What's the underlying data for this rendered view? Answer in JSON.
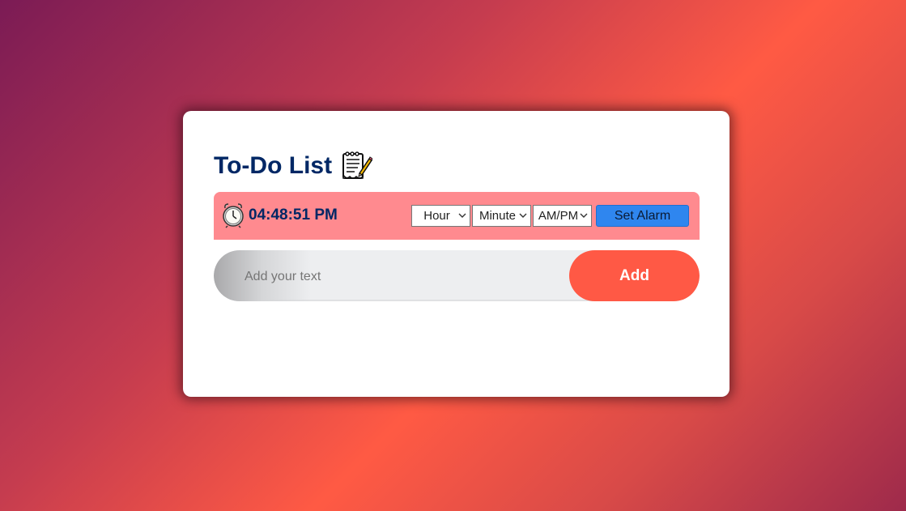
{
  "app": {
    "title": "To-Do List"
  },
  "alarm": {
    "current_time": "04:48:51 PM",
    "hour_select": {
      "selected": "Hour"
    },
    "minute_select": {
      "selected": "Minute"
    },
    "ampm_select": {
      "selected": "AM/PM"
    },
    "set_alarm_label": "Set Alarm"
  },
  "input": {
    "placeholder": "Add your text",
    "value": ""
  },
  "add_button_label": "Add",
  "icons": {
    "title_icon": "notepad-pencil-icon",
    "clock_icon": "alarm-clock-icon",
    "dropdown_icon": "chevron-down-icon"
  },
  "colors": {
    "title_color": "#002765",
    "alarm_bar_bg": "#ff8a8f",
    "set_alarm_bg": "#2f86ef",
    "add_button_bg": "#ff5945",
    "input_bg": "#edeef0"
  }
}
